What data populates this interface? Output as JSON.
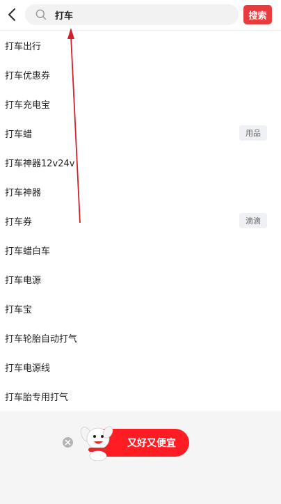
{
  "header": {
    "search_value": "打车",
    "search_button": "搜索",
    "back_icon": "chevron-left-icon",
    "search_icon": "search-icon"
  },
  "suggestions": [
    {
      "text": "打车出行",
      "tag": ""
    },
    {
      "text": "打车优惠券",
      "tag": ""
    },
    {
      "text": "打车充电宝",
      "tag": ""
    },
    {
      "text": "打车蜡",
      "tag": "用品"
    },
    {
      "text": "打车神器12v24v",
      "tag": ""
    },
    {
      "text": "打车神器",
      "tag": ""
    },
    {
      "text": "打车券",
      "tag": "滴滴"
    },
    {
      "text": "打车蜡白车",
      "tag": ""
    },
    {
      "text": "打车电源",
      "tag": ""
    },
    {
      "text": "打车宝",
      "tag": ""
    },
    {
      "text": "打车轮胎自动打气",
      "tag": ""
    },
    {
      "text": "打车电源线",
      "tag": ""
    },
    {
      "text": "打车胎专用打气",
      "tag": ""
    }
  ],
  "promo": {
    "text": "又好又便宜",
    "close_icon": "close-icon",
    "mascot": "dog-mascot-icon"
  },
  "colors": {
    "accent": "#e93b3d",
    "promo": "#ff1c23",
    "annotation_arrow": "#d0202a"
  }
}
